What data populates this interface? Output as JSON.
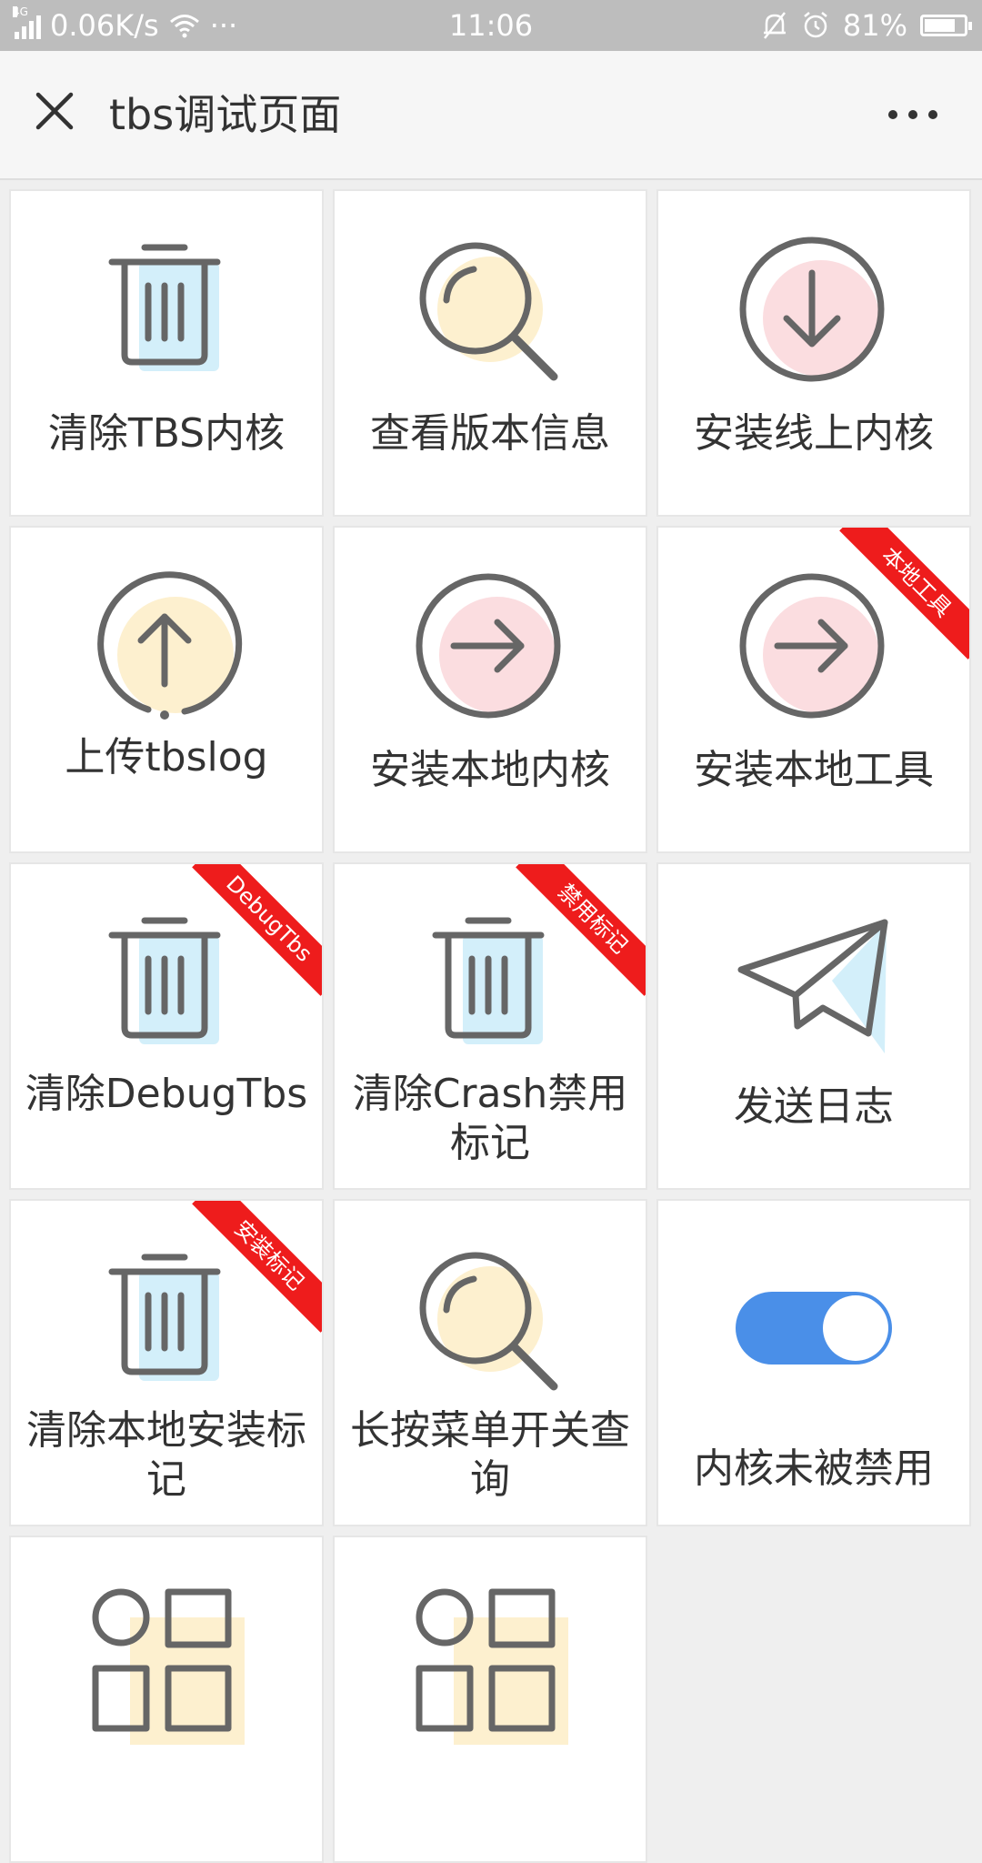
{
  "status_bar": {
    "network": "4G",
    "speed": "0.06K/s",
    "time": "11:06",
    "battery_percent": "81%",
    "battery_level": 0.81
  },
  "header": {
    "title": "tbs调试页面"
  },
  "colors": {
    "icon_stroke": "#666666",
    "blue_accent": "#d3effa",
    "yellow_accent": "#fdf0cf",
    "pink_accent": "#fbdde0",
    "ribbon": "#ee1c1c",
    "toggle_on": "#4a8fe8"
  },
  "tiles": [
    {
      "label": "清除TBS内核",
      "icon": "trash-icon",
      "accent": "blue"
    },
    {
      "label": "查看版本信息",
      "icon": "magnifier-icon",
      "accent": "yellow"
    },
    {
      "label": "安装线上内核",
      "icon": "download-circle-icon",
      "accent": "pink"
    },
    {
      "label": "上传tbslog",
      "icon": "upload-circle-icon",
      "accent": "yellow"
    },
    {
      "label": "安装本地内核",
      "icon": "arrow-right-circle-icon",
      "accent": "pink"
    },
    {
      "label": "安装本地工具",
      "icon": "arrow-right-circle-icon",
      "accent": "pink",
      "ribbon": "本地工具"
    },
    {
      "label": "清除DebugTbs",
      "icon": "trash-icon",
      "accent": "blue",
      "ribbon": "DebugTbs"
    },
    {
      "label": "清除Crash禁用标记",
      "icon": "trash-icon",
      "accent": "blue",
      "ribbon": "禁用标记"
    },
    {
      "label": "发送日志",
      "icon": "paper-plane-icon",
      "accent": "blue"
    },
    {
      "label": "清除本地安装标记",
      "icon": "trash-icon",
      "accent": "blue",
      "ribbon": "安装标记"
    },
    {
      "label": "长按菜单开关查询",
      "icon": "magnifier-icon",
      "accent": "yellow"
    },
    {
      "label": "内核未被禁用",
      "icon": "toggle-switch-icon",
      "accent": "blue"
    },
    {
      "label": "",
      "icon": "grid-apps-icon",
      "accent": "yellow"
    },
    {
      "label": "",
      "icon": "grid-apps-icon",
      "accent": "yellow"
    }
  ]
}
